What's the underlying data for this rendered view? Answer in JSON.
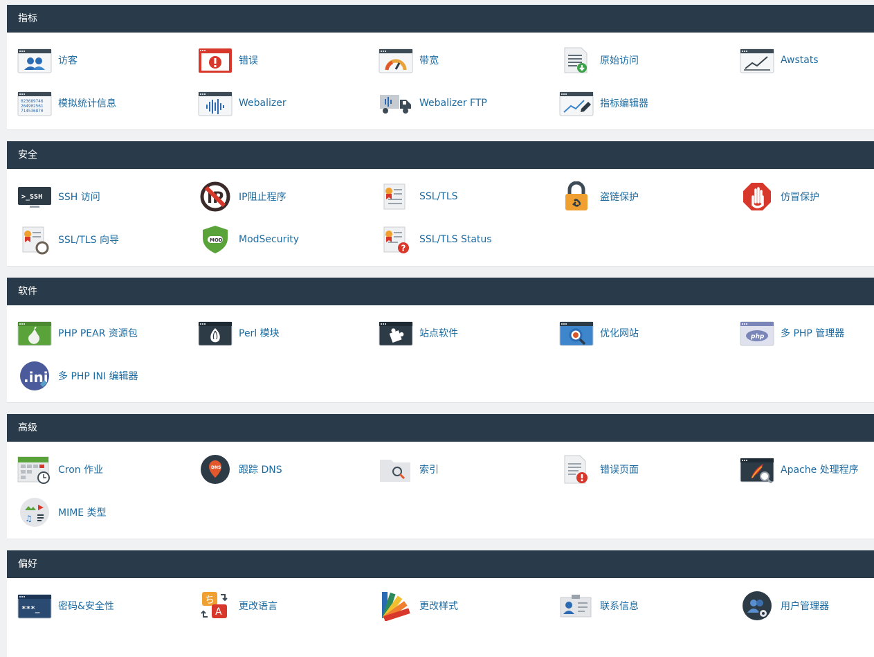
{
  "sections": [
    {
      "title": "指标",
      "items": [
        {
          "label": "访客",
          "icon": "visitors-icon"
        },
        {
          "label": "错误",
          "icon": "errors-icon"
        },
        {
          "label": "带宽",
          "icon": "bandwidth-icon"
        },
        {
          "label": "原始访问",
          "icon": "raw-access-icon"
        },
        {
          "label": "Awstats",
          "icon": "awstats-icon"
        },
        {
          "label": "模拟统计信息",
          "icon": "analog-stats-icon"
        },
        {
          "label": "Webalizer",
          "icon": "webalizer-icon"
        },
        {
          "label": "Webalizer FTP",
          "icon": "webalizer-ftp-icon"
        },
        {
          "label": "指标编辑器",
          "icon": "metrics-editor-icon"
        }
      ]
    },
    {
      "title": "安全",
      "items": [
        {
          "label": "SSH 访问",
          "icon": "ssh-terminal-icon"
        },
        {
          "label": "IP阻止程序",
          "icon": "ip-blocker-icon"
        },
        {
          "label": "SSL/TLS",
          "icon": "certificate-icon"
        },
        {
          "label": "盗链保护",
          "icon": "lock-link-icon"
        },
        {
          "label": "仿冒保护",
          "icon": "stop-hand-icon"
        },
        {
          "label": "SSL/TLS 向导",
          "icon": "certificate-wizard-icon"
        },
        {
          "label": "ModSecurity",
          "icon": "mod-shield-icon"
        },
        {
          "label": "SSL/TLS Status",
          "icon": "certificate-status-icon"
        }
      ]
    },
    {
      "title": "软件",
      "items": [
        {
          "label": "PHP PEAR 资源包",
          "icon": "pear-icon"
        },
        {
          "label": "Perl 模块",
          "icon": "perl-onion-icon"
        },
        {
          "label": "站点软件",
          "icon": "site-software-puzzle-icon"
        },
        {
          "label": "优化网站",
          "icon": "optimize-magnifier-icon"
        },
        {
          "label": "多 PHP 管理器",
          "icon": "php-badge-icon"
        },
        {
          "label": "多 PHP INI 编辑器",
          "icon": "ini-editor-icon"
        }
      ]
    },
    {
      "title": "高级",
      "items": [
        {
          "label": "Cron 作业",
          "icon": "calendar-clock-icon"
        },
        {
          "label": "跟踪 DNS",
          "icon": "dns-pin-icon"
        },
        {
          "label": "索引",
          "icon": "folder-search-icon"
        },
        {
          "label": "错误页面",
          "icon": "error-page-icon"
        },
        {
          "label": "Apache 处理程序",
          "icon": "apache-feather-icon"
        },
        {
          "label": "MIME 类型",
          "icon": "mime-types-icon"
        }
      ]
    },
    {
      "title": "偏好",
      "items": [
        {
          "label": "密码&安全性",
          "icon": "password-icon"
        },
        {
          "label": "更改语言",
          "icon": "language-icon"
        },
        {
          "label": "更改样式",
          "icon": "color-fan-icon"
        },
        {
          "label": "联系信息",
          "icon": "contact-card-icon"
        },
        {
          "label": "用户管理器",
          "icon": "user-manager-icon"
        }
      ]
    }
  ],
  "colors": {
    "header_bg": "#293a4a",
    "link": "#1e6ba0",
    "page_bg": "#f0f1f3"
  }
}
